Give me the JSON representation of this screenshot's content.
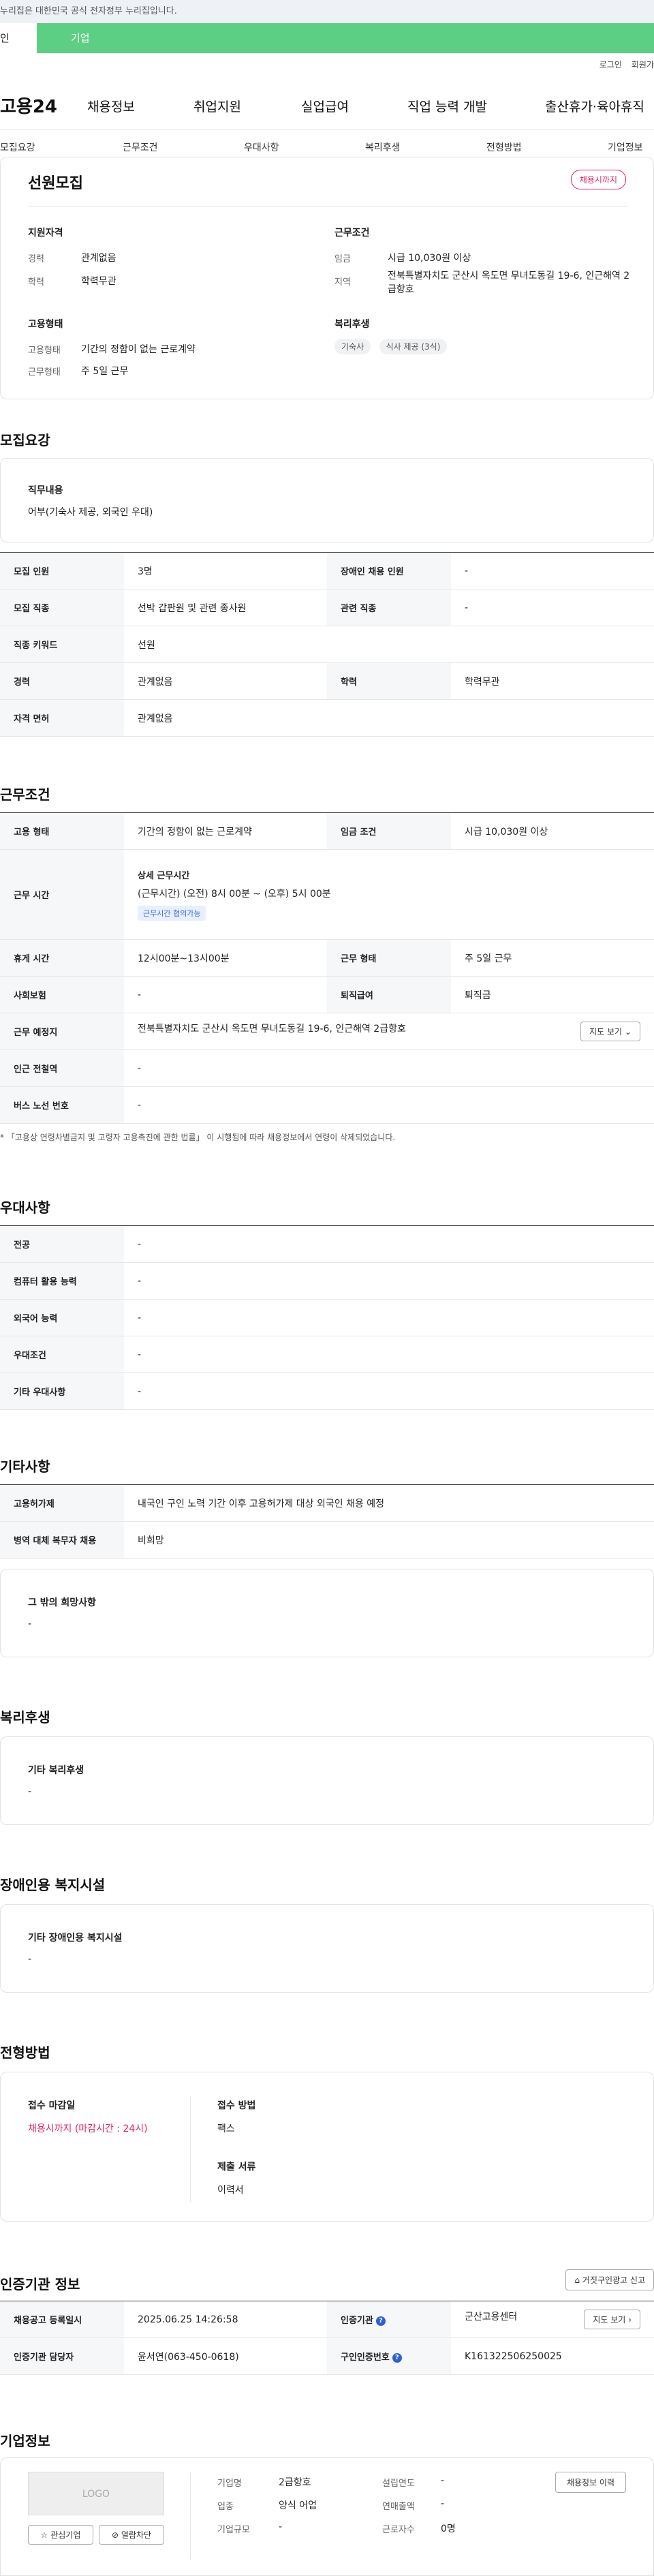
{
  "topbar": {
    "gov_notice": "누리집은 대한민국 공식 전자정부 누리집입니다.",
    "tab_person": "인",
    "tab_company": "기업"
  },
  "util": {
    "login": "로그인",
    "join": "회원가"
  },
  "gnb": {
    "logo": "고용24",
    "menu": [
      "채용정보",
      "취업지원",
      "실업급여",
      "직업 능력 개발",
      "출산휴가·육아휴직"
    ]
  },
  "sub_tabs": [
    "모집요강",
    "근무조건",
    "우대사항",
    "복리후생",
    "전형방법",
    "기업정보"
  ],
  "summary": {
    "title": "선원모집",
    "badge": "채용시까지",
    "qual_title": "지원자격",
    "career_label": "경력",
    "career_value": "관계없음",
    "edu_label": "학력",
    "edu_value": "학력무관",
    "cond_title": "근무조건",
    "wage_label": "임금",
    "wage_value": "시급 10,030원 이상",
    "region_label": "지역",
    "region_value": "전북특별자치도 군산시 옥도면 무녀도동길 19-6, 인근해역 2급항호",
    "emp_title": "고용형태",
    "emptype_label": "고용형태",
    "emptype_value": "기간의 정함이 없는 근로계약",
    "workform_label": "근무형태",
    "workform_value": "주 5일 근무",
    "welfare_title": "복리후생",
    "welfare_chips": [
      "기숙사",
      "식사 제공 (3식)"
    ]
  },
  "recruit": {
    "section": "모집요강",
    "duty_title": "직무내용",
    "duty_value": "어부(기숙사 제공, 외국인 우대)",
    "rows": [
      [
        "모집 인원",
        "3명",
        "장애인 채용 인원",
        "-"
      ],
      [
        "모집 직종",
        "선박 갑판원 및 관련 종사원",
        "관련 직종",
        "-"
      ],
      [
        "직종 키워드",
        "선원"
      ],
      [
        "경력",
        "관계없음",
        "학력",
        "학력무관"
      ],
      [
        "자격 면허",
        "관계없음"
      ]
    ]
  },
  "work": {
    "section": "근무조건",
    "emptype": [
      "고용 형태",
      "기간의 정함이 없는 근로계약",
      "임금 조건",
      "시급 10,030원 이상"
    ],
    "time_label": "근무 시간",
    "time_title": "상세 근무시간",
    "time_value": "(근무시간) (오전) 8시 00분 ~ (오후) 5시 00분",
    "time_tag": "근무시간 협의가능",
    "rows": [
      [
        "휴게 시간",
        "12시00분~13시00분",
        "근무 형태",
        "주 5일 근무"
      ],
      [
        "사회보험",
        "-",
        "퇴직급여",
        "퇴직금"
      ]
    ],
    "place_label": "근무 예정지",
    "place_value": "전북특별자치도 군산시 옥도면 무녀도동길 19-6, 인근해역 2급항호",
    "map_btn": "지도 보기",
    "subway_label": "인근 전철역",
    "subway_value": "-",
    "bus_label": "버스 노선 번호",
    "bus_value": "-",
    "note": "* 「고용상 연령차별금지 및 고령자 고용촉진에 관한 법률」 이 시행됨에 따라 채용정보에서 연령이 삭제되었습니다."
  },
  "prefer": {
    "section": "우대사항",
    "rows": [
      [
        "전공",
        "-"
      ],
      [
        "컴퓨터 활용 능력",
        "-"
      ],
      [
        "외국어 능력",
        "-"
      ],
      [
        "우대조건",
        "-"
      ],
      [
        "기타 우대사항",
        "-"
      ]
    ]
  },
  "etc": {
    "section": "기타사항",
    "rows": [
      [
        "고용허가제",
        "내국인 구인 노력 기간 이후 고용허가제 대상 외국인 채용 예정"
      ],
      [
        "병역 대체 복무자 채용",
        "비희망"
      ]
    ],
    "other_title": "그 밖의 희망사항",
    "other_value": "-"
  },
  "welfare": {
    "section": "복리후생",
    "title": "기타 복리후생",
    "value": "-"
  },
  "disabled": {
    "section": "장애인용 복지시설",
    "title": "기타 장애인용 복지시설",
    "value": "-"
  },
  "selection": {
    "section": "전형방법",
    "deadline_title": "접수 마감일",
    "deadline_value": "채용시까지 (마감시간 : 24시)",
    "method_title": "접수 방법",
    "method_value": "팩스",
    "docs_title": "제출 서류",
    "docs_value": "이력서"
  },
  "cert": {
    "section": "인증기관 정보",
    "report_btn": "거짓구인광고 신고",
    "rows": [
      [
        "채용공고 등록일시",
        "2025.06.25 14:26:58",
        "인증기관",
        "군산고용센터"
      ],
      [
        "인증기관 담당자",
        "윤서연(063-450-0618)",
        "구인인증번호",
        "K161322506250025"
      ]
    ],
    "map_btn": "지도 보기"
  },
  "company": {
    "section": "기업정보",
    "logo": "LOGO",
    "fav_btn": "관심기업",
    "block_btn": "열람차단",
    "history_btn": "채용정보 이력",
    "name_label": "기업명",
    "name_value": "2급항호",
    "industry_label": "업종",
    "industry_value": "양식 어업",
    "size_label": "기업규모",
    "size_value": "-",
    "year_label": "설립연도",
    "year_value": "-",
    "sales_label": "연매출액",
    "sales_value": "-",
    "workers_label": "근로자수",
    "workers_value": "0명"
  }
}
